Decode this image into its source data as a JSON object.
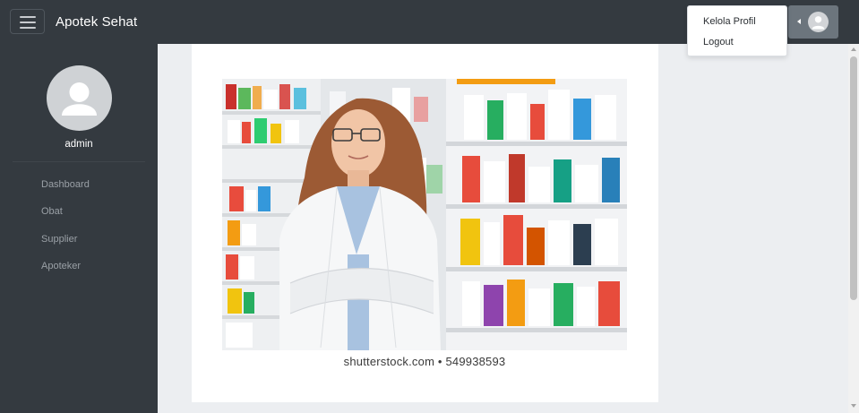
{
  "app": {
    "brand": "Apotek Sehat"
  },
  "header": {
    "menu_icon": "hamburger-menu-icon",
    "user_icon": "user-avatar-icon",
    "caret_icon": "caret-left-icon"
  },
  "user_menu": {
    "items": [
      {
        "label": "Kelola Profil"
      },
      {
        "label": "Logout"
      }
    ]
  },
  "sidebar": {
    "avatar_icon": "user-avatar-icon",
    "username": "admin",
    "items": [
      {
        "label": "Dashboard"
      },
      {
        "label": "Obat"
      },
      {
        "label": "Supplier"
      },
      {
        "label": "Apoteker"
      }
    ]
  },
  "main": {
    "image": {
      "subject": "pharmacist-photo",
      "caption": "shutterstock.com • 549938593"
    }
  },
  "colors": {
    "topbar": "#343a40",
    "sidebar": "#343a40",
    "user_toggle": "#6c757d",
    "content_bg": "#eceef1",
    "card": "#ffffff"
  }
}
